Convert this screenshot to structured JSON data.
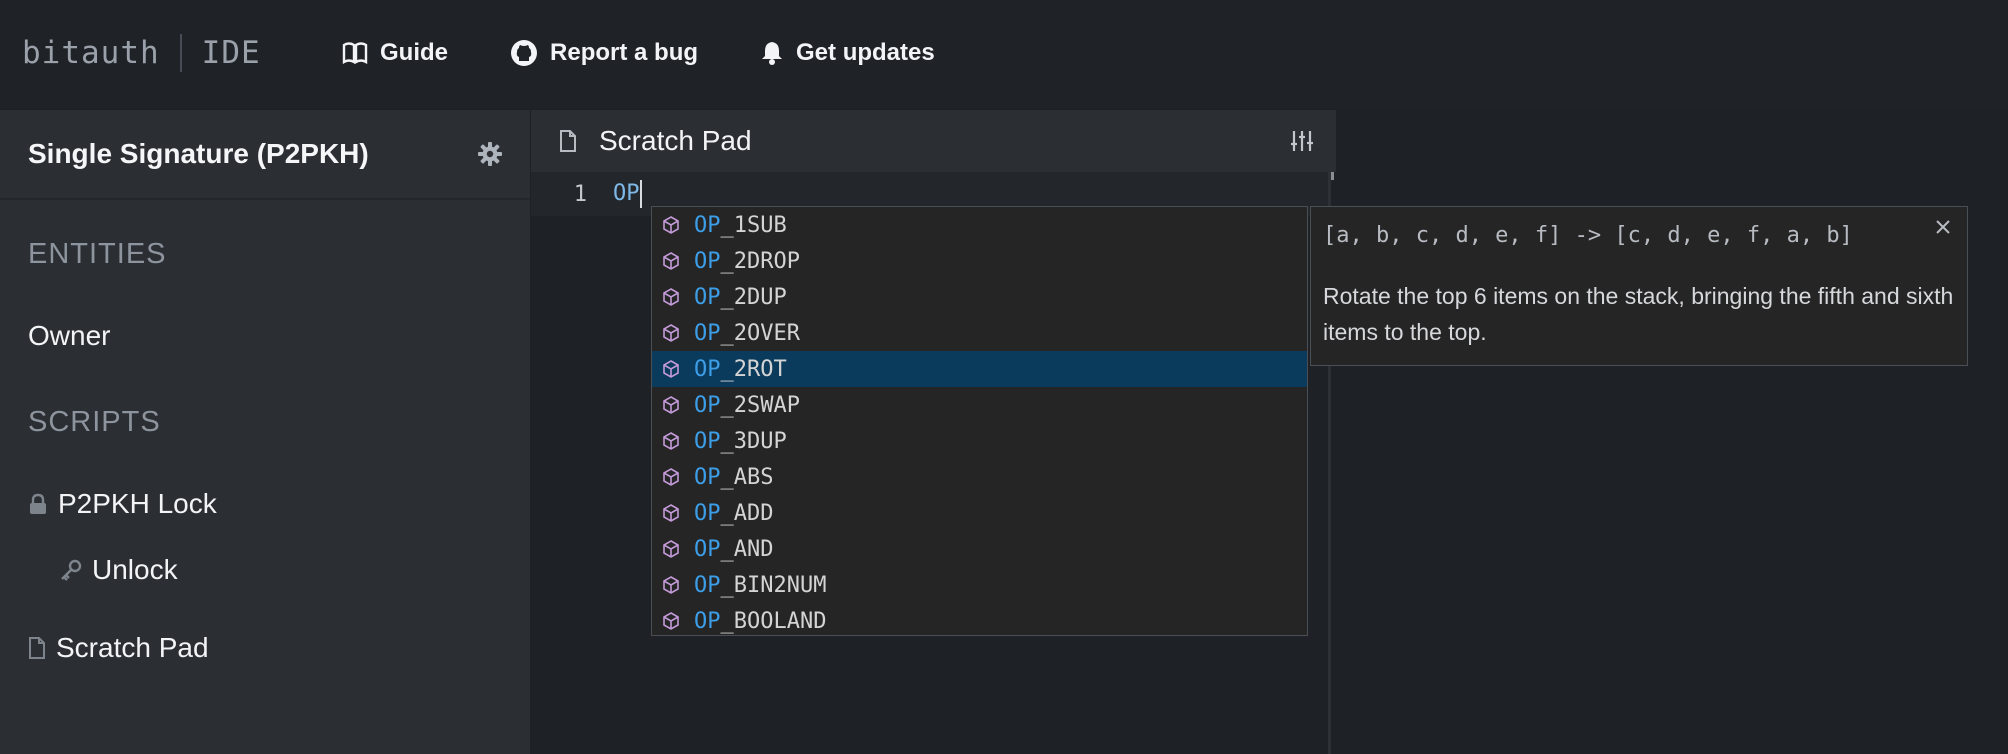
{
  "topbar": {
    "logo_left": "bitauth",
    "logo_right": "IDE",
    "nav": [
      {
        "label": "Guide",
        "icon": "book-icon"
      },
      {
        "label": "Report a bug",
        "icon": "github-icon"
      },
      {
        "label": "Get updates",
        "icon": "bell-icon"
      }
    ]
  },
  "sidebar": {
    "title": "Single Signature (P2PKH)",
    "sections": {
      "entities": "ENTITIES",
      "scripts": "SCRIPTS"
    },
    "entities": [
      "Owner"
    ],
    "scripts": [
      {
        "label": "P2PKH Lock",
        "icon": "lock-icon"
      },
      {
        "label": "Unlock",
        "icon": "key-icon"
      },
      {
        "label": "Scratch Pad",
        "icon": "file-icon"
      }
    ]
  },
  "editor": {
    "title": "Scratch Pad",
    "line_number": "1",
    "code": "OP"
  },
  "autocomplete": {
    "prefix": "OP",
    "items": [
      "_1SUB",
      "_2DROP",
      "_2DUP",
      "_2OVER",
      "_2ROT",
      "_2SWAP",
      "_3DUP",
      "_ABS",
      "_ADD",
      "_AND",
      "_BIN2NUM",
      "_BOOLAND"
    ],
    "selected_index": 4
  },
  "doc": {
    "signature": "[a, b, c, d, e, f] -> [c, d, e, f, a, b]",
    "description": "Rotate the top 6 items on the stack, bringing the fifth and sixth items to the top."
  },
  "colors": {
    "accent": "#3d9ee8",
    "selected_row": "#0a3a5c",
    "cube_icon": "#c49ad8"
  }
}
